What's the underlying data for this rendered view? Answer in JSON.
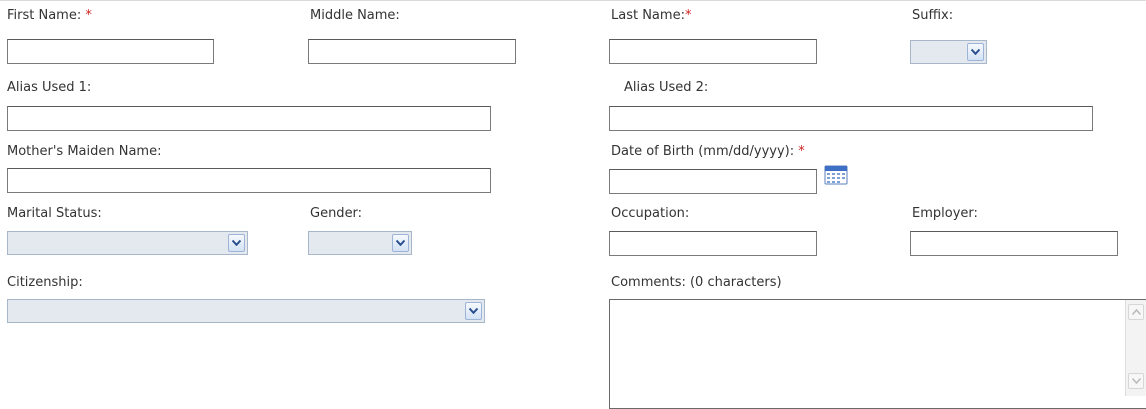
{
  "fields": {
    "first_name": {
      "label": "First Name:",
      "required_mark": "*",
      "value": ""
    },
    "middle_name": {
      "label": "Middle Name:",
      "value": ""
    },
    "last_name": {
      "label": "Last Name:",
      "required_mark": "*",
      "value": ""
    },
    "suffix": {
      "label": "Suffix:",
      "selected": ""
    },
    "alias_1": {
      "label": "Alias Used 1:",
      "value": ""
    },
    "alias_2": {
      "label": "Alias Used 2:",
      "value": ""
    },
    "mothers_maiden_name": {
      "label": "Mother's Maiden Name:",
      "value": ""
    },
    "date_of_birth": {
      "label": "Date of Birth (mm/dd/yyyy):",
      "required_mark": "*",
      "value": "",
      "icon": "calendar-icon"
    },
    "marital_status": {
      "label": "Marital Status:",
      "selected": ""
    },
    "gender": {
      "label": "Gender:",
      "selected": ""
    },
    "occupation": {
      "label": "Occupation:",
      "value": ""
    },
    "employer": {
      "label": "Employer:",
      "value": ""
    },
    "citizenship": {
      "label": "Citizenship:",
      "selected": ""
    },
    "comments": {
      "label": "Comments: (0 characters)",
      "value": ""
    }
  },
  "colors": {
    "required": "#cc2222",
    "select_background": "#e4e9f0",
    "select_border": "#a7b6c8",
    "dropdown_arrow": "#2a4f8f"
  },
  "icons": [
    "chevron-down-icon",
    "calendar-icon",
    "scroll-up-icon",
    "scroll-down-icon"
  ]
}
